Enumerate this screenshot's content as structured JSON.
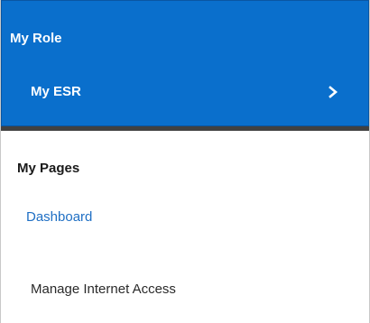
{
  "my_role": {
    "heading": "My Role",
    "items": [
      {
        "label": "My ESR",
        "icon": "chevron-right-icon"
      }
    ],
    "colors": {
      "panel_background": "#0a6fcc",
      "panel_text": "#ffffff",
      "divider": "#414141"
    }
  },
  "my_pages": {
    "heading": "My Pages",
    "links": [
      {
        "label": "Dashboard",
        "color": "#1f6fc4"
      },
      {
        "label": "Manage Internet Access",
        "color": "#2a2a2a"
      }
    ]
  }
}
